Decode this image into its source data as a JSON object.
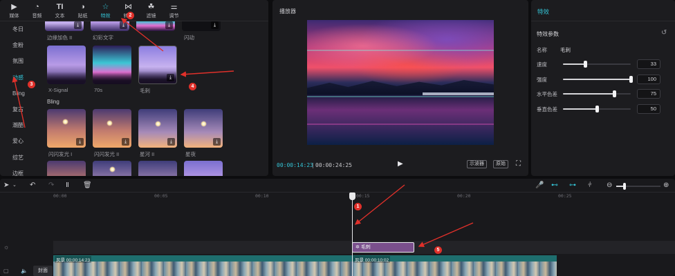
{
  "toolbar": {
    "items": [
      {
        "label": "媒体",
        "icon": "media-icon"
      },
      {
        "label": "音频",
        "icon": "audio-icon"
      },
      {
        "label": "文本",
        "icon": "text-icon"
      },
      {
        "label": "贴纸",
        "icon": "sticker-icon"
      },
      {
        "label": "特效",
        "icon": "effects-icon"
      },
      {
        "label": "转场",
        "icon": "transition-icon"
      },
      {
        "label": "滤镜",
        "icon": "filter-icon"
      },
      {
        "label": "调节",
        "icon": "adjust-icon"
      }
    ],
    "active_index": 4
  },
  "categories": [
    "冬日",
    "金粉",
    "氛围",
    "动感",
    "Bling",
    "复古",
    "潮酷",
    "爱心",
    "综艺",
    "边框"
  ],
  "active_category": "动感",
  "effects": {
    "row0_labels": [
      "边缘加色 II",
      "幻彩文字",
      "",
      "闪动"
    ],
    "row1_labels": [
      "X-Signal",
      "70s",
      "毛刺"
    ],
    "section_title": "Bling",
    "row2_labels": [
      "闪闪发光 I",
      "闪闪发光 II",
      "星河 II",
      "星夜"
    ]
  },
  "player": {
    "title": "播放器",
    "current_time": "00:00:14:23",
    "total_time": "00:00:24:25",
    "btn_scope": "示波器",
    "btn_original": "原始"
  },
  "effect_panel": {
    "title": "特效",
    "params_title": "特效参数",
    "name_label": "名称",
    "name_value": "毛刺",
    "params": [
      {
        "name": "速度",
        "value": 33
      },
      {
        "name": "强度",
        "value": 100
      },
      {
        "name": "水平色差",
        "value": 75
      },
      {
        "name": "垂直色差",
        "value": 50
      }
    ]
  },
  "timeline": {
    "ruler_labels": [
      "00:00",
      "00:05",
      "00:10",
      "00:15",
      "00:20",
      "00:25"
    ],
    "effect_clip_label": "毛刺",
    "video_clip_1": "风景  00:00:14:23",
    "video_clip_2": "风景  00:00:10:02",
    "cover_label": "封面"
  },
  "annotations": [
    "1",
    "2",
    "3",
    "4",
    "5"
  ],
  "colors": {
    "accent": "#34c4d6",
    "annotation": "#e0302a",
    "effect_clip": "#7a4f8c",
    "video_track": "#1e6e6e"
  }
}
